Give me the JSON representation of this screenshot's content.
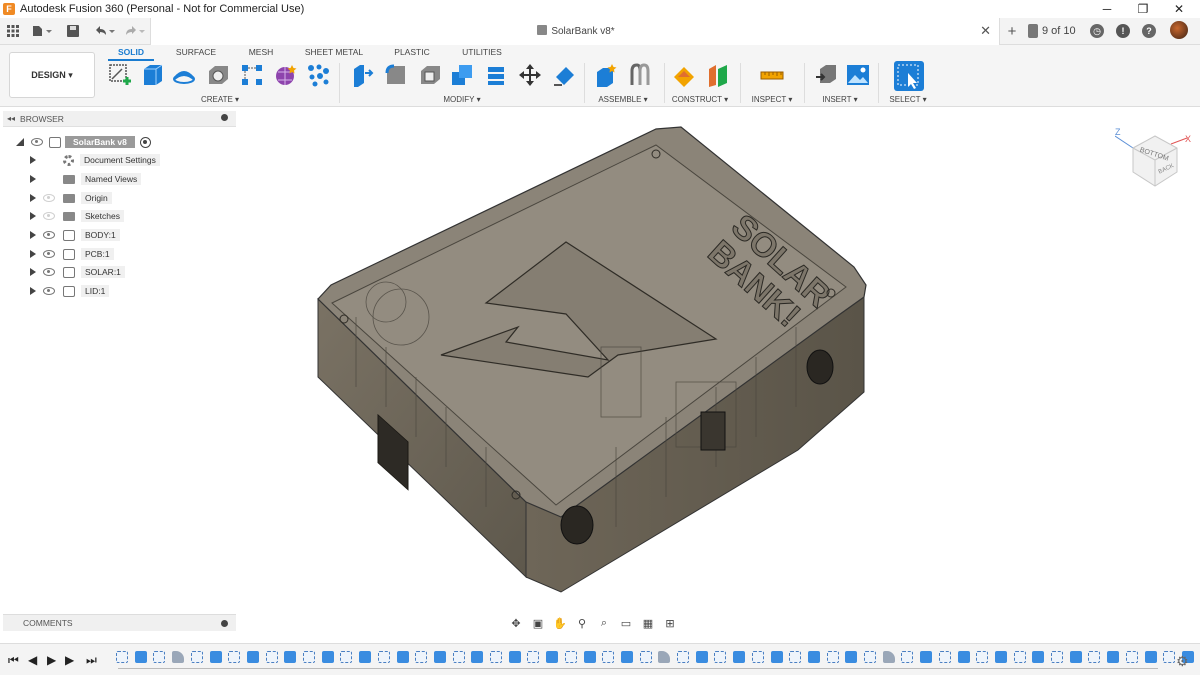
{
  "window": {
    "title": "Autodesk Fusion 360 (Personal - Not for Commercial Use)",
    "minimize_glyph": "─",
    "restore_glyph": "❐",
    "close_glyph": "✕"
  },
  "appbar": {
    "document_title": "SolarBank v8*",
    "version_label": "9 of 10",
    "job_icon": "clock-icon",
    "notifications_icon": "bell-icon",
    "help_icon": "help-icon"
  },
  "ribbon": {
    "workspace": "DESIGN ▾",
    "tabs": [
      "SOLID",
      "SURFACE",
      "MESH",
      "SHEET METAL",
      "PLASTIC",
      "UTILITIES"
    ],
    "active_tab": "SOLID",
    "groups": {
      "create": "CREATE ▾",
      "modify": "MODIFY ▾",
      "assemble": "ASSEMBLE ▾",
      "construct": "CONSTRUCT ▾",
      "inspect": "INSPECT ▾",
      "insert": "INSERT ▾",
      "select": "SELECT ▾"
    }
  },
  "browser": {
    "header": "BROWSER",
    "root": "SolarBank v8",
    "items": [
      {
        "label": "Document Settings",
        "icon": "gear-icon",
        "visible": null
      },
      {
        "label": "Named Views",
        "icon": "folder-icon",
        "visible": null
      },
      {
        "label": "Origin",
        "icon": "folder-icon",
        "visible": false
      },
      {
        "label": "Sketches",
        "icon": "folder-icon",
        "visible": false
      },
      {
        "label": "BODY:1",
        "icon": "component-icon",
        "visible": true
      },
      {
        "label": "PCB:1",
        "icon": "component-icon",
        "visible": true
      },
      {
        "label": "SOLAR:1",
        "icon": "component-icon",
        "visible": true
      },
      {
        "label": "LID:1",
        "icon": "component-icon",
        "visible": true
      }
    ]
  },
  "comments": {
    "header": "COMMENTS"
  },
  "model": {
    "embossed_text_line1": "SOLAR",
    "embossed_text_line2": "BANK!",
    "body_color": "#6e6658",
    "top_color": "#8b8478"
  },
  "viewcube": {
    "face_label": "BOTTOM",
    "side_label": "BACK",
    "axis_x": "X",
    "axis_z": "Z"
  },
  "timeline": {
    "features": [
      "sketch",
      "extrude",
      "sketch",
      "fillet",
      "sketch",
      "extrude",
      "sketch",
      "extrude",
      "sketch",
      "extrude",
      "sketch",
      "extrude",
      "sketch",
      "extrude",
      "sketch",
      "extrude",
      "sketch",
      "extrude",
      "sketch",
      "extrude",
      "sketch",
      "extrude",
      "sketch",
      "extrude",
      "sketch",
      "extrude",
      "sketch",
      "extrude",
      "sketch",
      "fillet",
      "sketch",
      "extrude",
      "sketch",
      "extrude",
      "sketch",
      "extrude",
      "sketch",
      "extrude",
      "sketch",
      "extrude",
      "sketch",
      "fillet",
      "sketch",
      "extrude",
      "sketch",
      "extrude",
      "sketch",
      "extrude",
      "sketch",
      "extrude",
      "sketch",
      "extrude",
      "sketch",
      "extrude",
      "sketch",
      "extrude",
      "sketch",
      "extrude",
      "sketch",
      "extrude"
    ]
  }
}
